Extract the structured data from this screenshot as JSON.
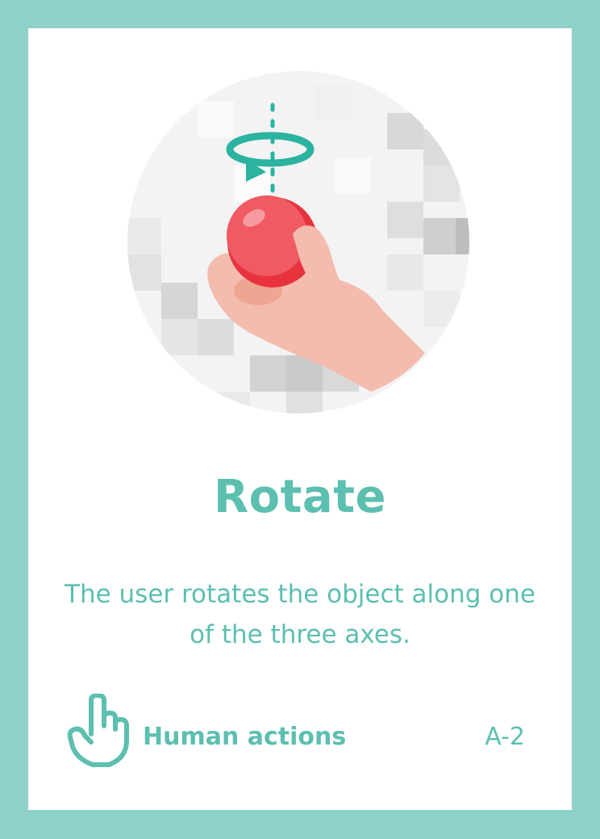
{
  "card": {
    "title": "Rotate",
    "description": "The user rotates the object along one of the three axes.",
    "category": "Human actions",
    "code": "A-2"
  },
  "icons": {
    "illustration": "hand-rotating-ball-illustration",
    "category_icon": "pointing-hand-icon"
  },
  "colors": {
    "border": "#8dd1c8",
    "accent": "#5cbfb0",
    "ball": "#e8333f",
    "hand": "#f3bcae",
    "arrow": "#2bb3a0"
  }
}
